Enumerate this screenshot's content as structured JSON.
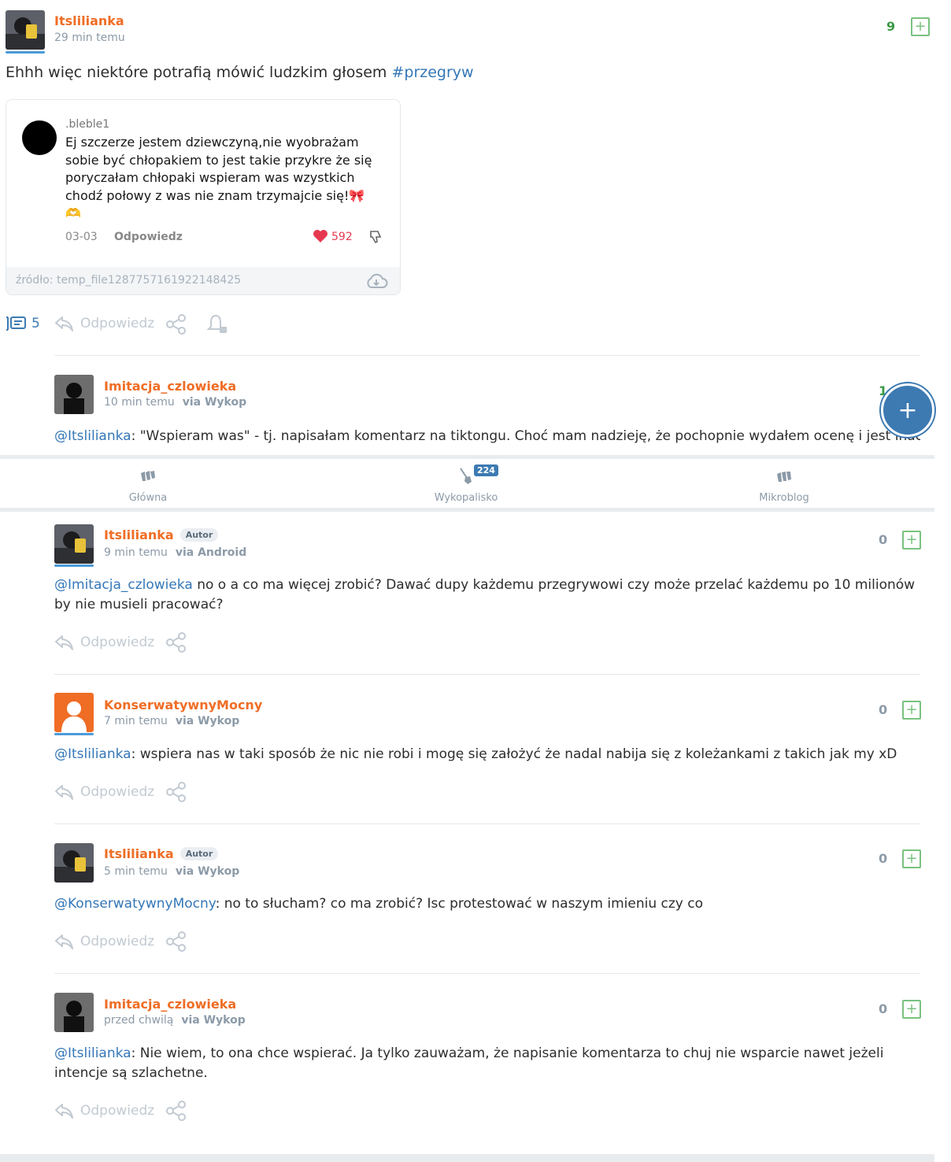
{
  "main_post": {
    "author": "Itslilianka",
    "time": "29 min temu",
    "score": "9",
    "text_prefix": "Ehhh więc niektóre potrafią mówić ludzkim głosem ",
    "tag": "#przegryw",
    "embed": {
      "username": ".bleble1",
      "text": "Ej szczerze jestem dziewczyną,nie wyobrażam sobie być chłopakiem to jest takie przykre że się poryczałam chłopaki wspieram was wzystkich chodź połowy z was nie znam trzymajcie się!🎀🫶",
      "date": "03-03",
      "reply": "Odpowiedz",
      "likes": "592",
      "source": "źródło: temp_file1287757161922148425"
    },
    "comments_count": "5",
    "reply_label": "Odpowiedz"
  },
  "comments": [
    {
      "author": "Imitacja_czlowieka",
      "time": "10 min temu",
      "via": "via Wykop",
      "score": "1",
      "mention": "@Itslilianka",
      "text": ": \"Wspieram was\" - tj. napisałam komentarz na tiktongu. Choć mam nadzieję, że pochopnie wydałem ocenę i jest inaczej"
    },
    {
      "author": "Itslilianka",
      "badge": "Autor",
      "time": "9 min temu",
      "via": "via Android",
      "score": "0",
      "mention": "@Imitacja_czlowieka",
      "text": " no o a co ma więcej zrobić? Dawać dupy każdemu przegrywowi czy może przelać każdemu po 10 milionów by nie musieli pracować?",
      "reply_label": "Odpowiedz"
    },
    {
      "author": "KonserwatywnyMocny",
      "time": "7 min temu",
      "via": "via Wykop",
      "score": "0",
      "mention": "@Itslilianka",
      "text": ": wspiera nas w taki sposób że nic nie robi i mogę się założyć że nadal nabija się z koleżankami z takich jak my xD",
      "reply_label": "Odpowiedz"
    },
    {
      "author": "Itslilianka",
      "badge": "Autor",
      "time": "5 min temu",
      "via": "via Wykop",
      "score": "0",
      "mention": "@KonserwatywnyMocny",
      "text": ": no to słucham? co ma zrobić? Isc protestować w naszym imieniu czy co",
      "reply_label": "Odpowiedz"
    },
    {
      "author": "Imitacja_czlowieka",
      "time": "przed chwilą",
      "via": "via Wykop",
      "score": "0",
      "mention": "@Itslilianka",
      "text": ": Nie wiem, to ona chce wspierać. Ja tylko zauważam, że napisanie komentarza to chuj nie wsparcie nawet jeżeli intencje są szlachetne.",
      "reply_label": "Odpowiedz"
    }
  ],
  "bottom_nav": {
    "items": [
      {
        "label": "Główna",
        "icon": "wykop-logo-icon"
      },
      {
        "label": "Wykopalisko",
        "icon": "shovel-icon",
        "badge": "224"
      },
      {
        "label": "Mikroblog",
        "icon": "mikroblog-icon"
      }
    ]
  },
  "fab_label": "+",
  "colors": {
    "accent": "#ef6d25",
    "link": "#3477b8",
    "plus": "#79c27f",
    "nav_active": "#3d7ab2"
  }
}
